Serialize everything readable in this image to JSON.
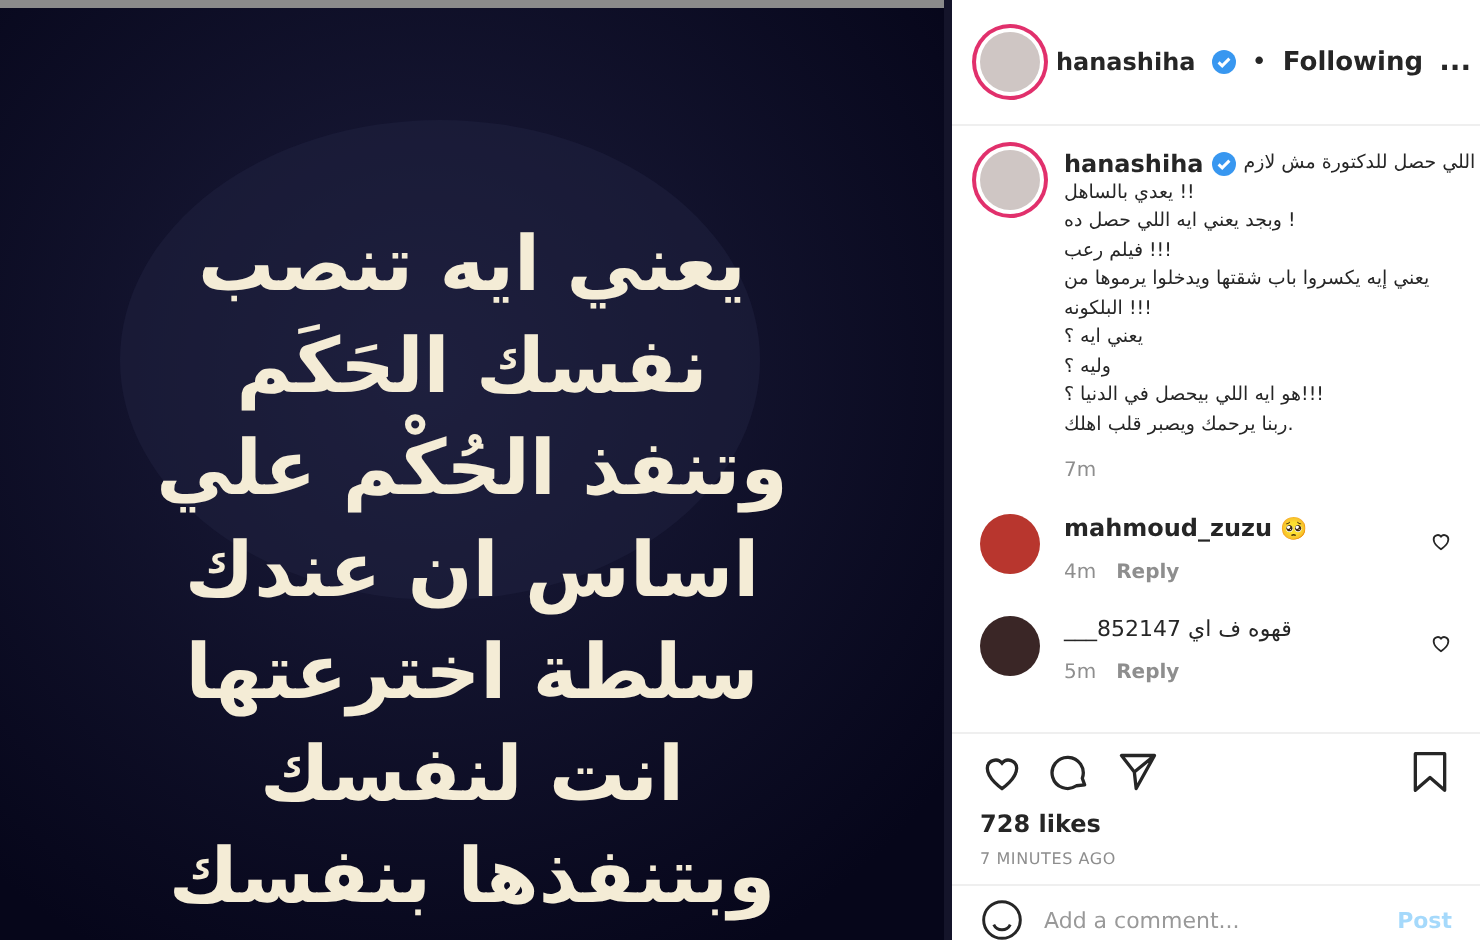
{
  "post_image": {
    "lines": [
      "يعني ايه تنصب",
      "نفسك الحَكَم",
      "وتنفذ الحُكْم علي",
      "اساس ان عندك",
      "سلطة اخترعتها",
      "انت لنفسك",
      "وبتنفذها بنفسك"
    ]
  },
  "header": {
    "username": "hanashiha",
    "separator": "•",
    "follow_status": "Following",
    "more": "..."
  },
  "caption": {
    "username": "hanashiha",
    "lines": [
      "اللي حصل للدكتورة مش لازم",
      "!! يعدي بالساهل",
      "! وبجد يعني ايه اللي حصل ده",
      "!!! فيلم رعب",
      "يعني إيه يكسروا باب شقتها ويدخلوا يرموها من",
      "!!! البلكونه",
      "يعني ايه ؟",
      "وليه ؟",
      "!!!هو ايه اللي بيحصل في الدنيا ؟",
      ".ربنا يرحمك ويصبر قلب اهلك"
    ],
    "time": "7m"
  },
  "comments": [
    {
      "username": "mahmoud_zuzu",
      "text": "🥺",
      "time": "4m",
      "reply": "Reply",
      "liked": false
    },
    {
      "text": "قهوه ف اي 852147___",
      "time": "5m",
      "reply": "Reply",
      "liked": false
    }
  ],
  "actions": {
    "liked": false,
    "saved": false
  },
  "likes": "728 likes",
  "timestamp": "7 MINUTES AGO",
  "add_comment": {
    "placeholder": "Add a comment...",
    "post": "Post",
    "disabled": true
  }
}
